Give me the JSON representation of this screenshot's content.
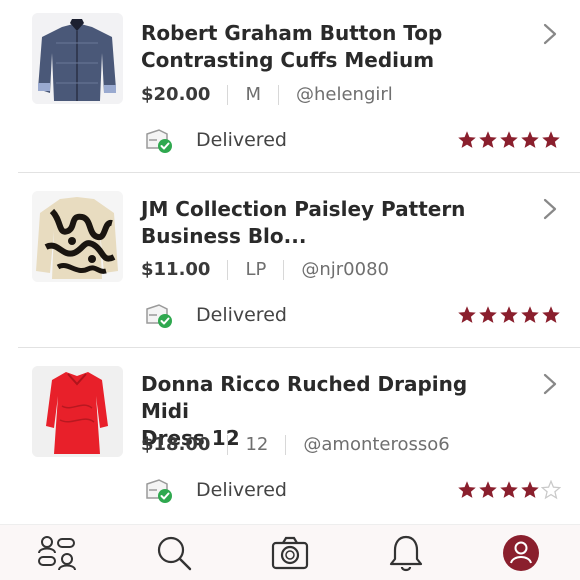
{
  "orders": [
    {
      "title_line1": "Robert Graham Button Top",
      "title_line2": "Contrasting Cuffs Medium",
      "price": "$20.00",
      "size": "M",
      "seller": "@helengirl",
      "status": "Delivered",
      "rating": 5,
      "thumb_icon": "shirt-photo"
    },
    {
      "title_line1": "JM Collection Paisley Pattern",
      "title_line2": "Business Blo...",
      "price": "$11.00",
      "size": "LP",
      "seller": "@njr0080",
      "status": "Delivered",
      "rating": 5,
      "thumb_icon": "blouse-photo"
    },
    {
      "title_line1": "Donna Ricco Ruched Draping Midi",
      "title_line2": "Dress 12",
      "price": "$18.00",
      "size": "12",
      "seller": "@amonterosso6",
      "status": "Delivered",
      "rating": 4,
      "thumb_icon": "dress-photo"
    }
  ],
  "nav": {
    "items": [
      "closet-icon",
      "search-icon",
      "camera-icon",
      "bell-icon",
      "account-icon"
    ],
    "active": "account-icon"
  },
  "colors": {
    "star": "#8a1f2d",
    "star_empty": "#c9c9c9",
    "check": "#2fa84f",
    "accent": "#8a1f2d"
  }
}
